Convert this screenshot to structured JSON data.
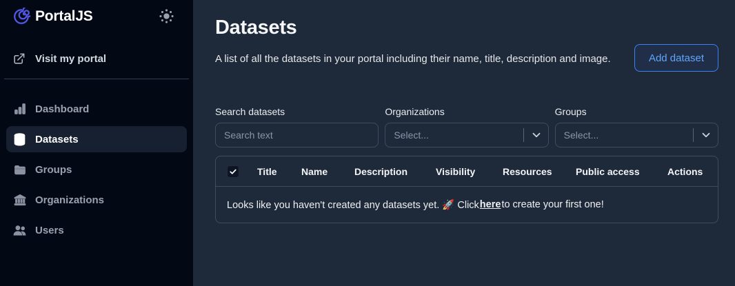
{
  "brand": {
    "name": "PortalJS",
    "logo_icon": "spiral-icon",
    "theme_toggle_icon": "sun-icon"
  },
  "sidebar": {
    "portal_link": {
      "label": "Visit my portal",
      "icon": "external-link-icon"
    },
    "items": [
      {
        "label": "Dashboard",
        "icon": "bar-chart-icon",
        "active": false
      },
      {
        "label": "Datasets",
        "icon": "database-icon",
        "active": true
      },
      {
        "label": "Groups",
        "icon": "folder-icon",
        "active": false
      },
      {
        "label": "Organizations",
        "icon": "bank-icon",
        "active": false
      },
      {
        "label": "Users",
        "icon": "users-icon",
        "active": false
      }
    ]
  },
  "header": {
    "title": "Datasets",
    "description": "A list of all the datasets in your portal including their name, title, description and image.",
    "add_button_label": "Add dataset"
  },
  "filters": {
    "search": {
      "label": "Search datasets",
      "placeholder": "Search text",
      "value": ""
    },
    "organizations": {
      "label": "Organizations",
      "placeholder": "Select..."
    },
    "groups": {
      "label": "Groups",
      "placeholder": "Select..."
    }
  },
  "table": {
    "select_all_checked": true,
    "columns": [
      "Title",
      "Name",
      "Description",
      "Visibility",
      "Resources",
      "Public access",
      "Actions"
    ],
    "empty_state": {
      "text_before_link": "Looks like you haven't created any datasets yet. 🚀 Click ",
      "link_text": "here",
      "text_after_link": " to create your first one!"
    }
  },
  "colors": {
    "sidebar_bg": "#030914",
    "main_bg": "#1e2939",
    "accent_blue": "#3b82f6",
    "accent_blue_text": "#60a5fa",
    "logo_indigo": "#5357e6",
    "border": "#414c5e"
  }
}
